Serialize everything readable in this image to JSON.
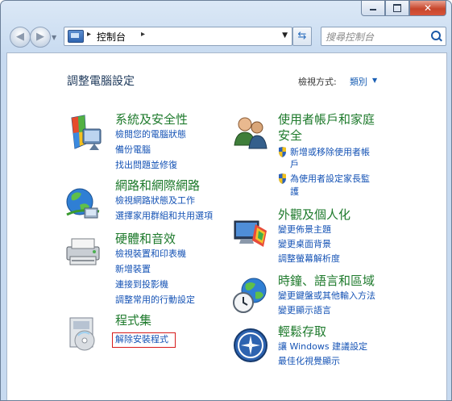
{
  "window": {
    "caption": {
      "minimize": "▁",
      "maximize": "▢",
      "close": "✕"
    }
  },
  "nav": {
    "breadcrumb": "控制台",
    "search_placeholder": "搜尋控制台"
  },
  "content": {
    "title": "調整電腦設定",
    "view_by_label": "檢視方式:",
    "view_by_value": "類別"
  },
  "categories": {
    "system": {
      "title": "系統及安全性",
      "links": [
        "檢閱您的電腦狀態",
        "備份電腦",
        "找出問題並修復"
      ]
    },
    "network": {
      "title": "網路和網際網路",
      "links": [
        "檢視網路狀態及工作",
        "選擇家用群組和共用選項"
      ]
    },
    "hardware": {
      "title": "硬體和音效",
      "links": [
        "檢視裝置和印表機",
        "新增裝置",
        "連接到投影機",
        "調整常用的行動設定"
      ]
    },
    "programs": {
      "title": "程式集",
      "links": [
        "解除安裝程式"
      ]
    },
    "users": {
      "title_line1": "使用者帳戶和家庭",
      "title_line2": "安全",
      "links": [
        "新增或移除使用者帳",
        "戶",
        "為使用者設定家長監",
        "護"
      ]
    },
    "appearance": {
      "title": "外觀及個人化",
      "links": [
        "變更佈景主題",
        "變更桌面背景",
        "調整螢幕解析度"
      ]
    },
    "clock": {
      "title": "時鐘、語言和區域",
      "links": [
        "變更鍵盤或其他輸入方法",
        "變更顯示語言"
      ]
    },
    "ease": {
      "title": "輕鬆存取",
      "links": [
        "讓 Windows 建議設定",
        "最佳化視覺顯示"
      ]
    }
  },
  "colors": {
    "category_title": "#1e7a2c",
    "link": "#1553b5",
    "highlight": "#d61b1b"
  }
}
